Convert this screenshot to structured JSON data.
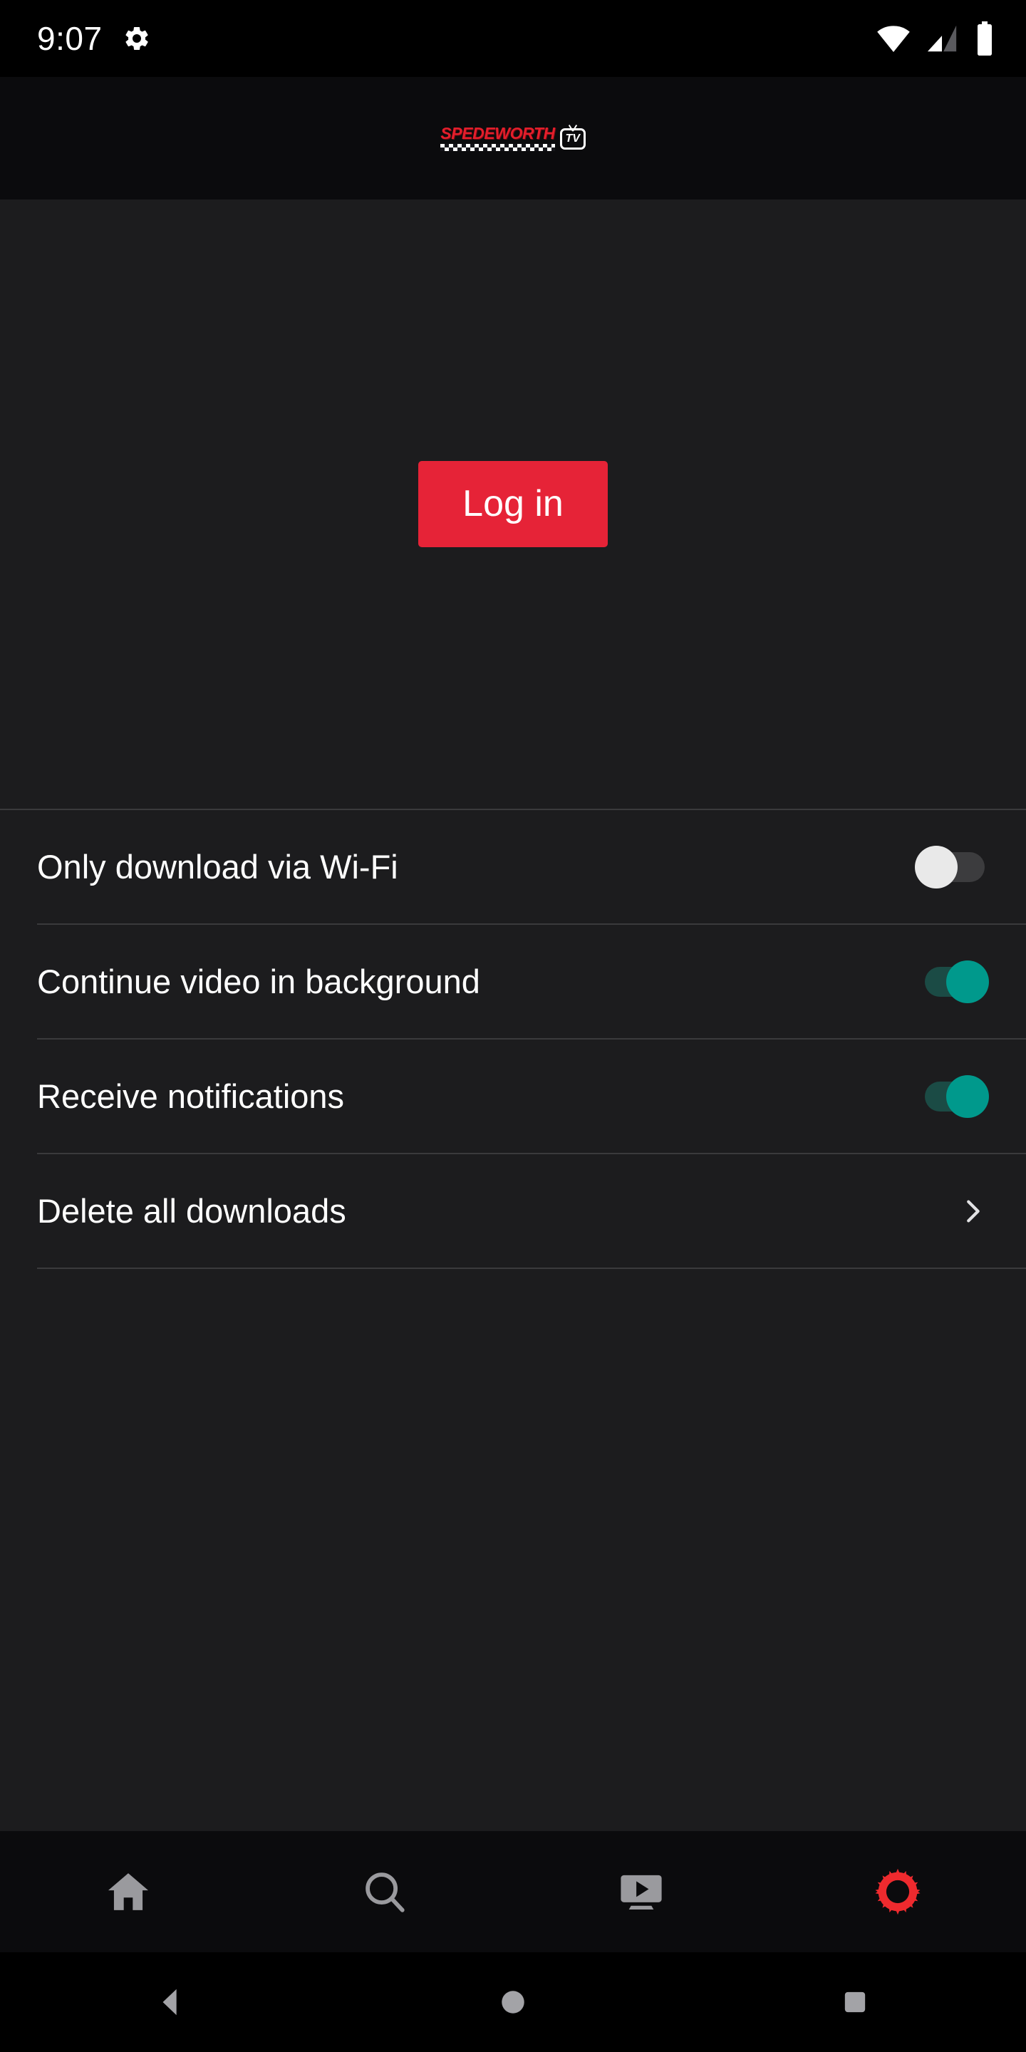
{
  "status_bar": {
    "time": "9:07",
    "gear_icon": "gear-icon",
    "wifi_icon": "wifi-icon",
    "cellular_icon": "cellular-signal-icon",
    "battery_icon": "battery-full-icon"
  },
  "header": {
    "logo_text": "SPEDEWORTH",
    "logo_badge": "TV"
  },
  "login": {
    "label": "Log in"
  },
  "settings": {
    "rows": [
      {
        "label": "Only download via Wi-Fi",
        "type": "toggle",
        "value": "off"
      },
      {
        "label": "Continue video in background",
        "type": "toggle",
        "value": "on"
      },
      {
        "label": "Receive notifications",
        "type": "toggle",
        "value": "on"
      },
      {
        "label": "Delete all downloads",
        "type": "chevron",
        "value": ""
      }
    ]
  },
  "bottom_nav": {
    "items": [
      {
        "name": "home",
        "icon": "home-icon",
        "active": false
      },
      {
        "name": "search",
        "icon": "search-icon",
        "active": false
      },
      {
        "name": "videos",
        "icon": "video-player-icon",
        "active": false
      },
      {
        "name": "settings",
        "icon": "cog-icon",
        "active": true
      }
    ]
  },
  "android_nav": {
    "back": "back-triangle-icon",
    "home": "home-circle-icon",
    "recents": "recents-square-icon"
  },
  "colors": {
    "accent_red": "#E62337",
    "logo_red": "#E31E2B",
    "toggle_on": "#00998C",
    "toggle_on_track": "#1B4B45",
    "toggle_off_knob": "#E9E9E9",
    "toggle_off_track": "#3C3C3E",
    "nav_inactive": "#9A9A9E",
    "bg_content": "#1C1C1E",
    "bg_chrome": "#0B0B0D"
  }
}
